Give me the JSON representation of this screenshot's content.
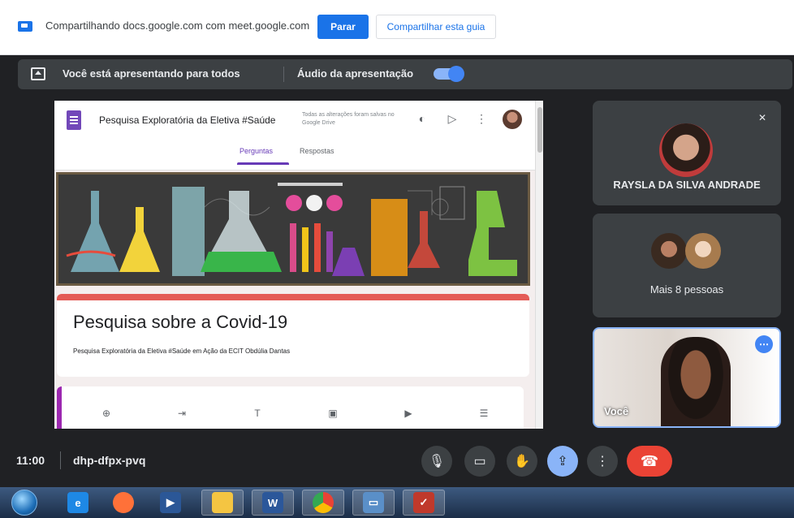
{
  "share_bar": {
    "text": "Compartilhando docs.google.com com meet.google.com",
    "stop_label": "Parar",
    "share_tab_label": "Compartilhar esta guia"
  },
  "presenting_bar": {
    "status": "Você está apresentando para todos",
    "audio_label": "Áudio da apresentação",
    "audio_on": true
  },
  "form": {
    "doc_title": "Pesquisa Exploratória da Eletiva #Saúde",
    "saved_status": "Todas as alterações foram salvas no Google Drive",
    "tabs": [
      "Perguntas",
      "Respostas"
    ],
    "heading": "Pesquisa sobre a Covid-19",
    "description": "Pesquisa Exploratória da Eletiva #Saúde em Ação da ECIT Obdúlia Dantas",
    "tools": [
      "add-question-icon",
      "import-questions-icon",
      "add-title-icon",
      "add-image-icon",
      "add-video-icon",
      "add-section-icon"
    ]
  },
  "participants": {
    "tile1": {
      "name": "RAYSLA DA SILVA ANDRADE",
      "muted": true
    },
    "tile2": {
      "name": "Mais 8 pessoas"
    },
    "tile3": {
      "name": "Você"
    }
  },
  "controls": {
    "time": "11:00",
    "meeting_code": "dhp-dfpx-pvq"
  },
  "colors": {
    "accent": "#1a73e8",
    "present_toggle": "#8ab4f8",
    "end_call": "#ea4335",
    "form_theme": "#673ab7",
    "form_card_accent": "#e45b56"
  }
}
